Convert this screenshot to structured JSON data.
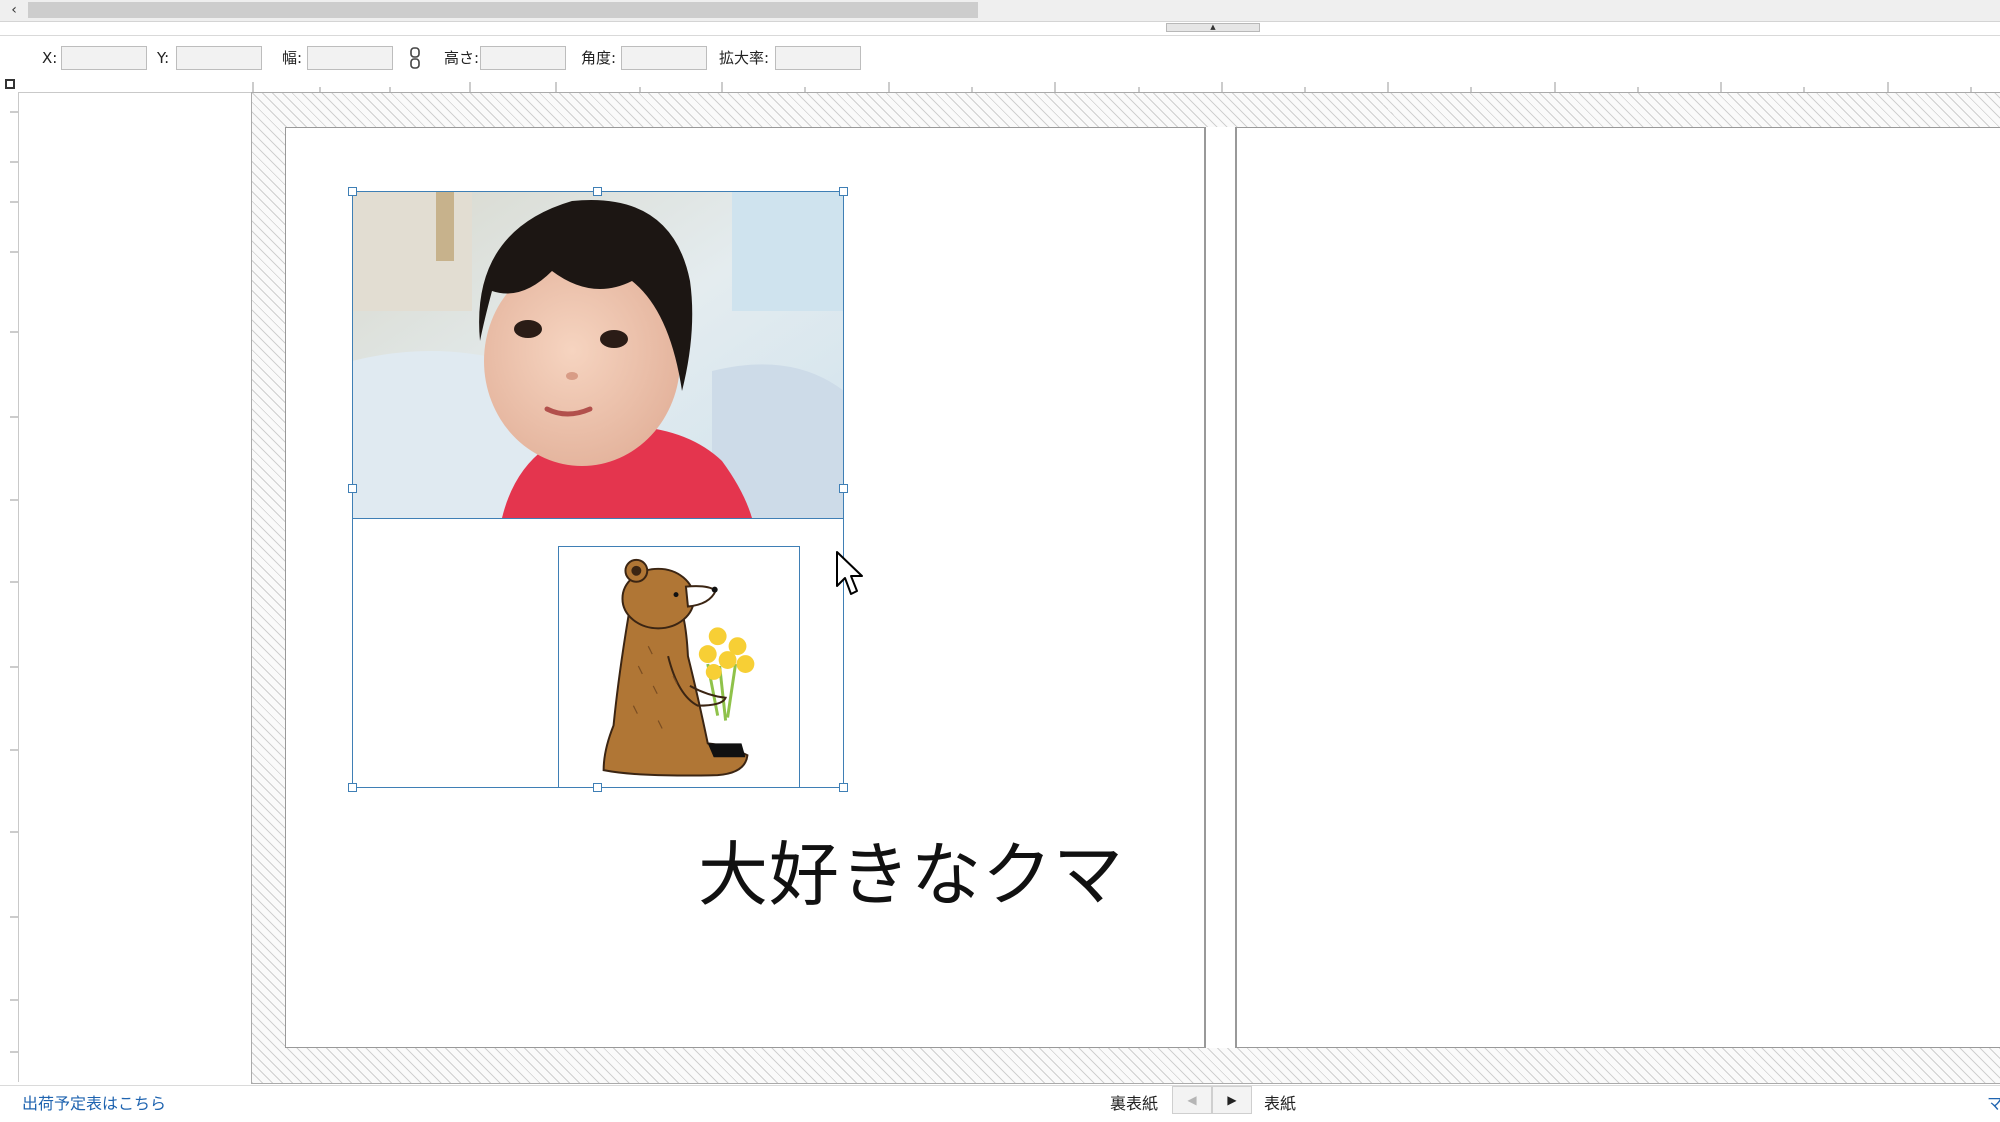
{
  "toolbar": {
    "x_label": "X:",
    "y_label": "Y:",
    "width_label": "幅:",
    "height_label": "高さ:",
    "angle_label": "角度:",
    "scale_label": "拡大率:",
    "x_value": "",
    "y_value": "",
    "width_value": "",
    "height_value": "",
    "angle_value": "",
    "scale_value": ""
  },
  "canvas": {
    "caption_text": "大好きなクマ"
  },
  "status": {
    "shipping_link": "出荷予定表はこちら",
    "back_cover": "裏表紙",
    "front_cover": "表紙",
    "corner_text": "マ"
  },
  "icons": {
    "scroll_left": "chevron-left-icon",
    "collapse": "chevron-up-icon",
    "link": "chain-link-icon",
    "prev": "triangle-left-icon",
    "next": "triangle-right-icon",
    "cursor": "mouse-pointer-icon"
  },
  "colors": {
    "selection": "#3f7fb5",
    "link_text": "#1f64b0"
  }
}
